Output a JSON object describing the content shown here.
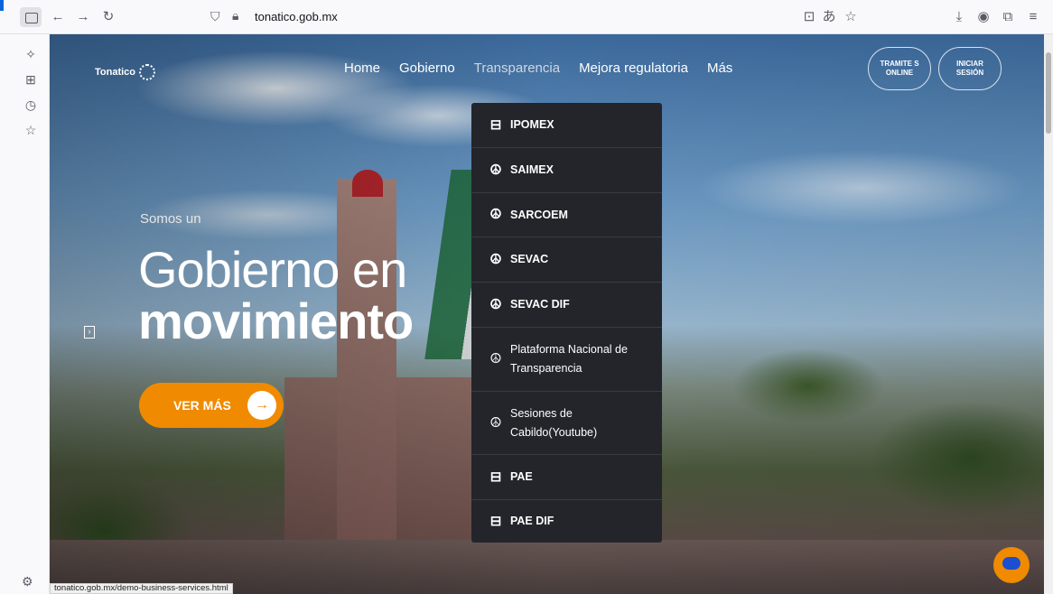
{
  "browser": {
    "url": "tonatico.gob.mx",
    "status_url": "tonatico.gob.mx/demo-business-services.html",
    "toolbar_icons": [
      "sidebar-icon",
      "back-icon",
      "forward-icon",
      "reload-icon",
      "shield-icon",
      "lock-icon",
      "save-page-icon",
      "translate-icon",
      "bookmark-star-icon",
      "download-icon",
      "account-icon",
      "extensions-icon",
      "menu-icon"
    ],
    "rail_icons": [
      "ai-chat-icon",
      "synced-tabs-icon",
      "history-icon",
      "bookmarks-icon",
      "settings-icon"
    ]
  },
  "site": {
    "logo_text": "Tonatico",
    "nav": [
      {
        "label": "Home"
      },
      {
        "label": "Gobierno"
      },
      {
        "label": "Transparencia"
      },
      {
        "label": "Mejora regulatoria"
      },
      {
        "label": "Más"
      }
    ],
    "tramite_button": "TRAMITE S ONLINE",
    "login_button": "INICIAR SESIÓN",
    "hero": {
      "intro": "Somos un",
      "line1": "Gobierno en",
      "line2": "movimiento",
      "cta": "VER MÁS"
    },
    "dropdown": [
      {
        "label": "IPOMEX",
        "icon": "briefcase-icon",
        "glyph": "⊟"
      },
      {
        "label": "SAIMEX",
        "icon": "peace-icon",
        "glyph": "☮"
      },
      {
        "label": "SARCOEM",
        "icon": "peace-icon",
        "glyph": "☮"
      },
      {
        "label": "SEVAC",
        "icon": "peace-icon",
        "glyph": "☮"
      },
      {
        "label": "SEVAC DIF",
        "icon": "peace-icon",
        "glyph": "☮"
      },
      {
        "label": "Plataforma Nacional de Transparencia",
        "icon": "peace-icon",
        "glyph": "☮"
      },
      {
        "label": "Sesiones de Cabildo(Youtube)",
        "icon": "peace-icon",
        "glyph": "☮"
      },
      {
        "label": "PAE",
        "icon": "briefcase-icon",
        "glyph": "⊟"
      },
      {
        "label": "PAE DIF",
        "icon": "briefcase-icon",
        "glyph": "⊟"
      }
    ]
  },
  "colors": {
    "accent_orange": "#f08a00",
    "dropdown_bg": "#23252b",
    "chat_blue": "#1a4fd0"
  }
}
